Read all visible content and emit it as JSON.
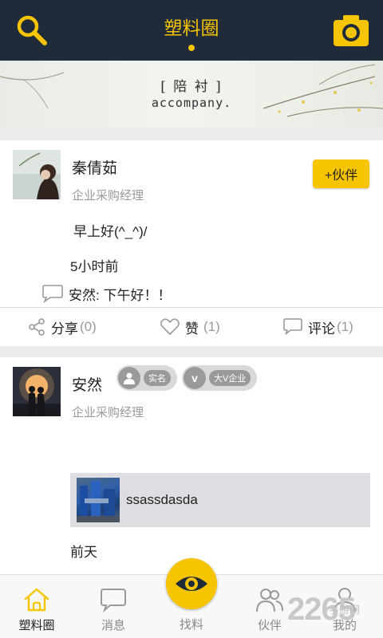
{
  "header": {
    "title": "塑料圈"
  },
  "banner": {
    "title_cn": "[ 陪 衬 ]",
    "title_en": "accompany."
  },
  "posts": [
    {
      "name": "秦倩茹",
      "role": "企业采购经理",
      "add_label": "+伙伴",
      "text": "早上好(^_^)/",
      "time": "5小时前",
      "comment": "安然: 下午好！！",
      "actions": {
        "share_label": "分享",
        "share_count": "(0)",
        "like_label": "赞",
        "like_count": "(1)",
        "comment_label": "评论",
        "comment_count": "(1)"
      }
    },
    {
      "name": "安然",
      "role": "企业采购经理",
      "badge_realname": "实名",
      "badge_vip": "大V企业",
      "badge_vip_icon": "v",
      "shared_text": "ssassdasda",
      "time": "前天"
    }
  ],
  "nav": {
    "items": [
      {
        "label": "塑料圈"
      },
      {
        "label": "消息"
      },
      {
        "label": "找料"
      },
      {
        "label": "伙伴"
      },
      {
        "label": "我的"
      }
    ]
  },
  "watermark": {
    "big": "2265",
    "small": "手游网"
  },
  "colors": {
    "accent": "#f7c400",
    "header_bg": "#1f2a3b"
  }
}
